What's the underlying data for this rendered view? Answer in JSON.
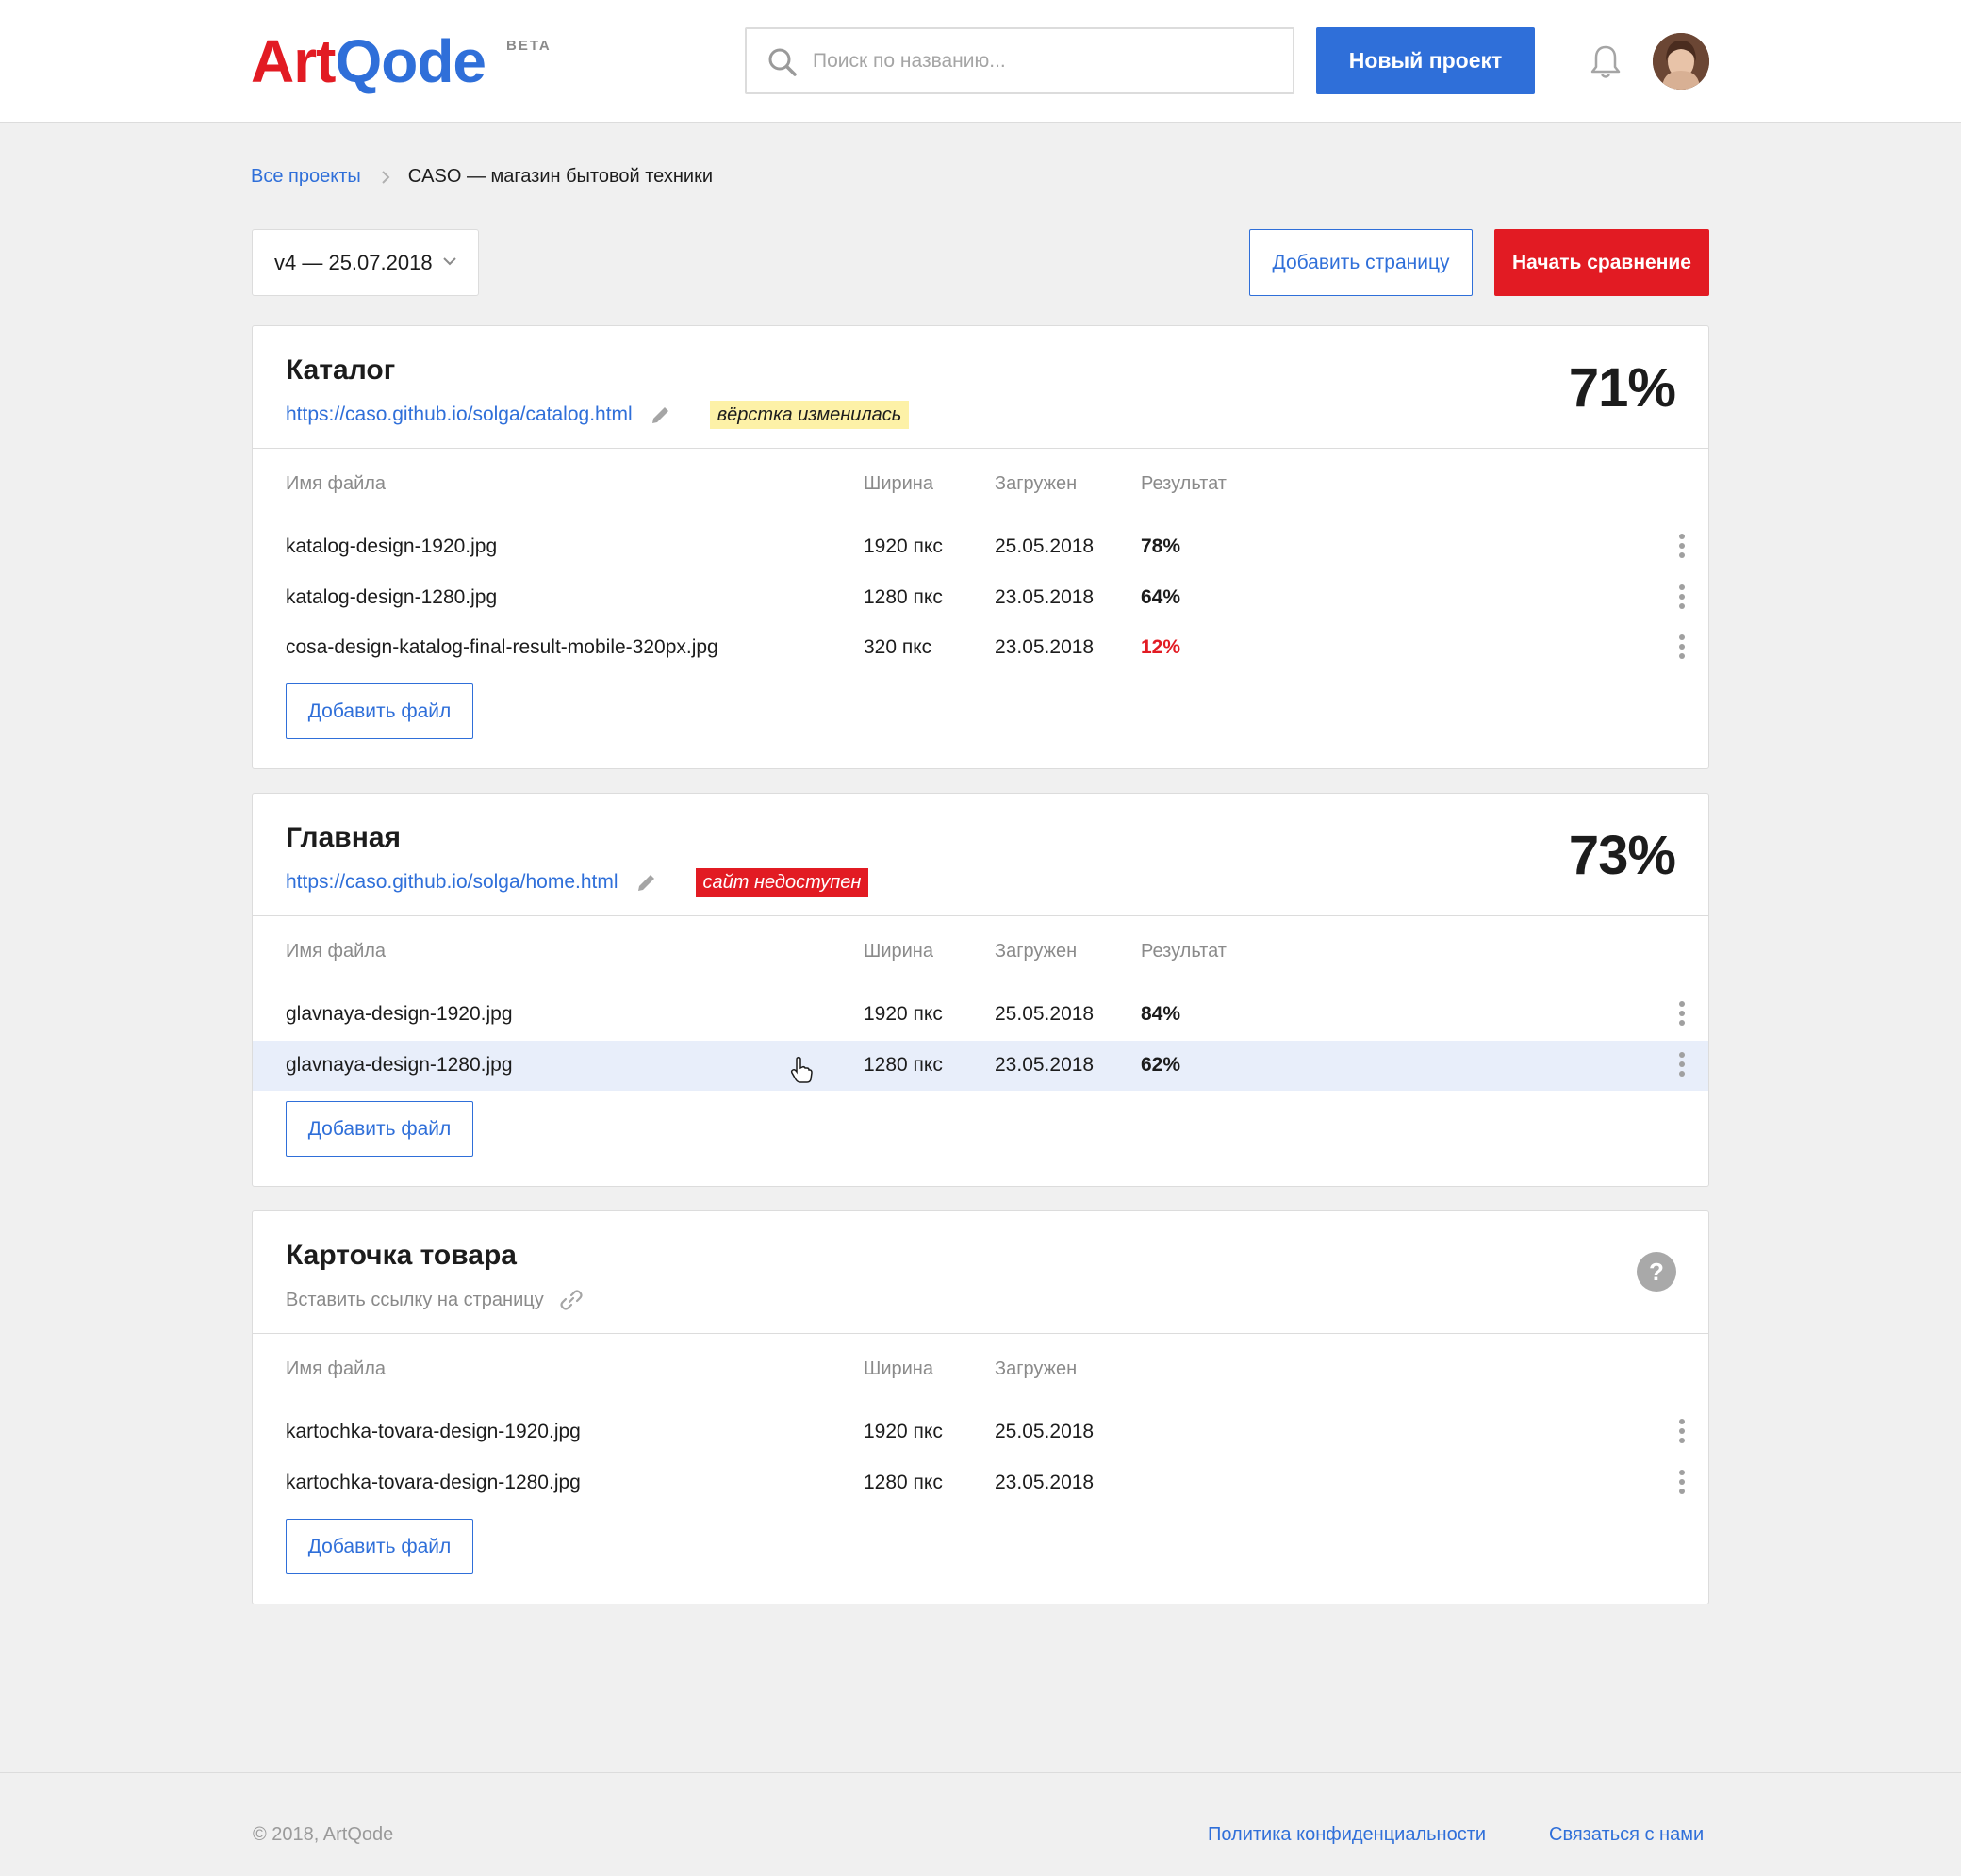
{
  "header": {
    "logo_part1": "Art",
    "logo_part2": "Qode",
    "beta": "BETA",
    "search_placeholder": "Поиск по названию...",
    "new_project": "Новый проект"
  },
  "breadcrumb": {
    "root": "Все проекты",
    "current": "CASO — магазин бытовой техники"
  },
  "toolbar": {
    "version": "v4 — 25.07.2018",
    "add_page": "Добавить страницу",
    "start_compare": "Начать сравнение"
  },
  "columns": {
    "name": "Имя файла",
    "width": "Ширина",
    "uploaded": "Загружен",
    "result": "Результат"
  },
  "add_file_label": "Добавить файл",
  "pages": [
    {
      "title": "Каталог",
      "url": "https://caso.github.io/solga/catalog.html",
      "badge": "вёрстка изменилась",
      "percent": "71%",
      "files": [
        {
          "name": "katalog-design-1920.jpg",
          "width": "1920 пкс",
          "date": "25.05.2018",
          "result": "78%"
        },
        {
          "name": "katalog-design-1280.jpg",
          "width": "1280 пкс",
          "date": "23.05.2018",
          "result": "64%"
        },
        {
          "name": "cosa-design-katalog-final-result-mobile-320px.jpg",
          "width": "320 пкс",
          "date": "23.05.2018",
          "result": "12%"
        }
      ]
    },
    {
      "title": "Главная",
      "url": "https://caso.github.io/solga/home.html",
      "badge": "сайт недоступен",
      "percent": "73%",
      "files": [
        {
          "name": "glavnaya-design-1920.jpg",
          "width": "1920 пкс",
          "date": "25.05.2018",
          "result": "84%"
        },
        {
          "name": "glavnaya-design-1280.jpg",
          "width": "1280 пкс",
          "date": "23.05.2018",
          "result": "62%"
        }
      ]
    },
    {
      "title": "Карточка товара",
      "url_placeholder": "Вставить ссылку на страницу",
      "help": "?",
      "files": [
        {
          "name": "kartochka-tovara-design-1920.jpg",
          "width": "1920 пкс",
          "date": "25.05.2018"
        },
        {
          "name": "kartochka-tovara-design-1280.jpg",
          "width": "1280 пкс",
          "date": "23.05.2018"
        }
      ]
    }
  ],
  "footer": {
    "copyright": "© 2018, ArtQode",
    "privacy": "Политика конфиденциальности",
    "contact": "Связаться с нами"
  },
  "colors": {
    "brand_red": "#e21b23",
    "brand_blue": "#2f6fd9",
    "badge_yellow": "#fdf1a7",
    "row_hover": "#e8eefa"
  }
}
